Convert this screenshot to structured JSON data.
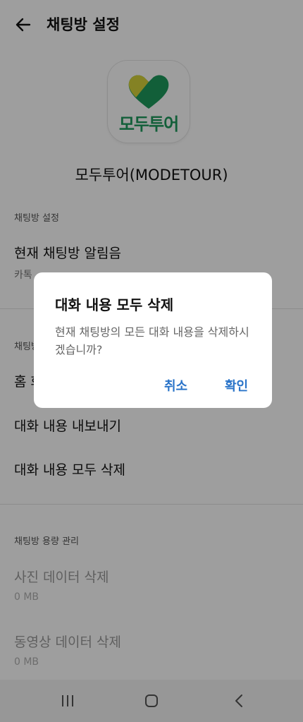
{
  "header": {
    "title": "채팅방 설정"
  },
  "profile": {
    "logo_text": "모두투어",
    "name": "모두투어(MODETOUR)"
  },
  "sections": {
    "chat_settings": {
      "label": "채팅방 설정",
      "notification_title": "현재 채팅방 알림음",
      "notification_sub": "카톡"
    },
    "chat_content": {
      "label": "채팅방",
      "home_item": "홈 화",
      "export": "대화 내용 내보내기",
      "delete_all": "대화 내용 모두 삭제"
    },
    "storage": {
      "label": "채팅방 용량 관리",
      "photo_title": "사진 데이터 삭제",
      "photo_size": "0 MB",
      "video_title": "동영상 데이터 삭제",
      "video_size": "0 MB"
    }
  },
  "dialog": {
    "title": "대화 내용 모두 삭제",
    "message": "현재 채팅방의 모든 대화 내용을 삭제하시겠습니까?",
    "cancel": "취소",
    "confirm": "확인"
  },
  "colors": {
    "accent": "#2a74c9",
    "logo_green": "#1d9a5c",
    "logo_yellow": "#d6d23a"
  },
  "icons": {
    "back": "arrow-left-icon",
    "nav_recent": "recent-apps-icon",
    "nav_home": "home-icon",
    "nav_back": "chevron-left-icon"
  }
}
